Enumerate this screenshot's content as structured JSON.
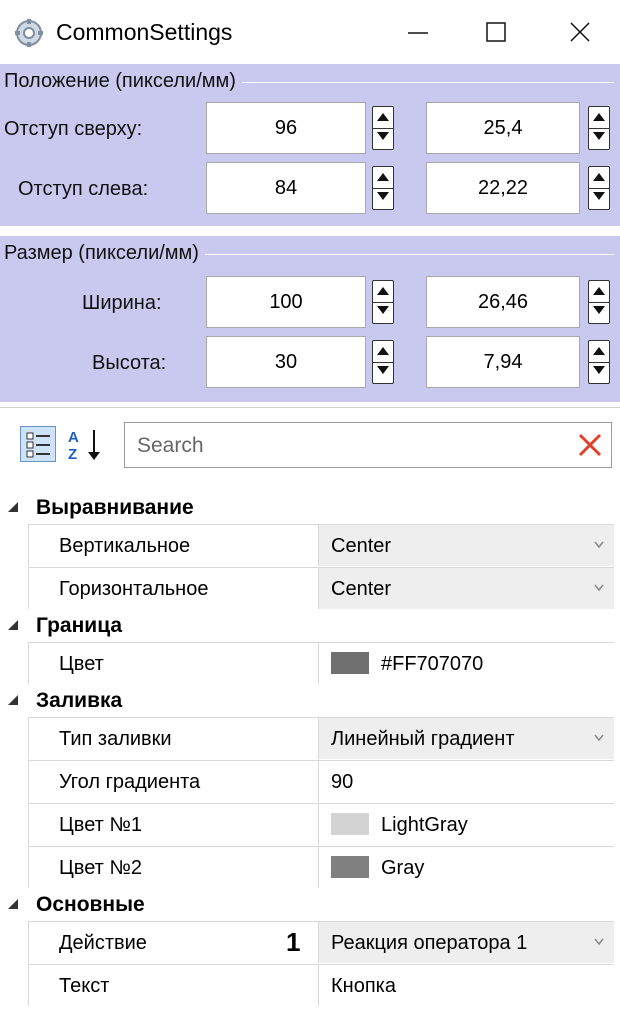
{
  "window": {
    "title": "CommonSettings",
    "controls": {
      "minimize_icon": "minimize-icon",
      "maximize_icon": "maximize-icon",
      "close_icon": "close-icon"
    }
  },
  "position_group": {
    "title": "Положение (пиксели/мм)",
    "rows": [
      {
        "label": "Отступ сверху:",
        "px": "96",
        "mm": "25,4"
      },
      {
        "label": "Отступ слева:",
        "px": "84",
        "mm": "22,22"
      }
    ]
  },
  "size_group": {
    "title": "Размер (пиксели/мм)",
    "rows": [
      {
        "label": "Ширина:",
        "px": "100",
        "mm": "26,46"
      },
      {
        "label": "Высота:",
        "px": "30",
        "mm": "7,94"
      }
    ]
  },
  "toolbar": {
    "categorized_icon": "categorized-view-icon",
    "sort_icon": "sort-az-icon",
    "search_placeholder": "Search",
    "clear_icon": "clear-search-icon"
  },
  "categories": [
    {
      "name": "Выравнивание",
      "properties": [
        {
          "name": "Вертикальное",
          "value": "Center",
          "editor": "combo"
        },
        {
          "name": "Горизонтальное",
          "value": "Center",
          "editor": "combo"
        }
      ]
    },
    {
      "name": "Граница",
      "properties": [
        {
          "name": "Цвет",
          "value": "#FF707070",
          "swatch": "#707070"
        }
      ]
    },
    {
      "name": "Заливка",
      "properties": [
        {
          "name": "Тип заливки",
          "value": "Линейный градиент",
          "editor": "combo"
        },
        {
          "name": "Угол градиента",
          "value": "90"
        },
        {
          "name": "Цвет №1",
          "value": "LightGray",
          "swatch": "#d3d3d3"
        },
        {
          "name": "Цвет №2",
          "value": "Gray",
          "swatch": "#808080"
        }
      ]
    },
    {
      "name": "Основные",
      "properties": [
        {
          "name": "Действие",
          "value": "Реакция оператора 1",
          "editor": "combo",
          "marker": "1"
        },
        {
          "name": "Текст",
          "value": "Кнопка"
        }
      ]
    }
  ],
  "colors": {
    "group_background": "#c9c9ef",
    "combo_background": "#eeeeee",
    "clear_icon": "#e0402a"
  }
}
